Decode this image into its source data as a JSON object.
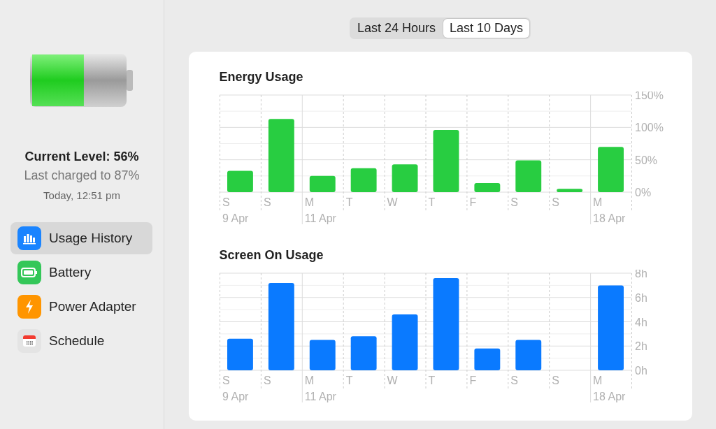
{
  "sidebar": {
    "battery": {
      "level": 0.56
    },
    "current_level": "Current Level: 56%",
    "last_charged": "Last charged to 87%",
    "charged_time": "Today, 12:51 pm",
    "items": [
      {
        "label": "Usage History",
        "kind": "history",
        "selected": true
      },
      {
        "label": "Battery",
        "kind": "battery",
        "selected": false
      },
      {
        "label": "Power Adapter",
        "kind": "power",
        "selected": false
      },
      {
        "label": "Schedule",
        "kind": "schedule",
        "selected": false
      }
    ]
  },
  "range_tabs": [
    {
      "label": "Last 24 Hours",
      "selected": false
    },
    {
      "label": "Last 10 Days",
      "selected": true
    }
  ],
  "charts": [
    {
      "x_labels": [
        {
          "day": "S",
          "date": "9 Apr"
        },
        {
          "day": "S"
        },
        {
          "day": "M",
          "date": "11 Apr"
        },
        {
          "day": "T"
        },
        {
          "day": "W"
        },
        {
          "day": "T"
        },
        {
          "day": "F"
        },
        {
          "day": "S"
        },
        {
          "day": "S"
        },
        {
          "day": "M",
          "date": "18 Apr"
        }
      ],
      "chart_data": {
        "type": "bar",
        "title": "Energy Usage",
        "grid": true,
        "series": [
          {
            "color": "#28cd41",
            "values": [
              33,
              113,
              25,
              37,
              43,
              96,
              14,
              49,
              5,
              70
            ]
          }
        ],
        "ylim": [
          0,
          150
        ],
        "yticks": [
          {
            "value": 0,
            "label": "0%"
          },
          {
            "value": 50,
            "label": "50%"
          },
          {
            "value": 100,
            "label": "100%"
          },
          {
            "value": 150,
            "label": "150%"
          }
        ]
      }
    },
    {
      "x_labels": [
        {
          "day": "S",
          "date": "9 Apr"
        },
        {
          "day": "S"
        },
        {
          "day": "M",
          "date": "11 Apr"
        },
        {
          "day": "T"
        },
        {
          "day": "W"
        },
        {
          "day": "T"
        },
        {
          "day": "F"
        },
        {
          "day": "S"
        },
        {
          "day": "S"
        },
        {
          "day": "M",
          "date": "18 Apr"
        }
      ],
      "chart_data": {
        "type": "bar",
        "title": "Screen On Usage",
        "grid": true,
        "series": [
          {
            "color": "#0a7aff",
            "values": [
              2.6,
              7.2,
              2.5,
              2.8,
              4.6,
              7.6,
              1.8,
              2.5,
              0,
              7.0
            ]
          }
        ],
        "ylim": [
          0,
          8
        ],
        "yticks": [
          {
            "value": 0,
            "label": "0h"
          },
          {
            "value": 2,
            "label": "2h"
          },
          {
            "value": 4,
            "label": "4h"
          },
          {
            "value": 6,
            "label": "6h"
          },
          {
            "value": 8,
            "label": "8h"
          }
        ]
      }
    }
  ]
}
